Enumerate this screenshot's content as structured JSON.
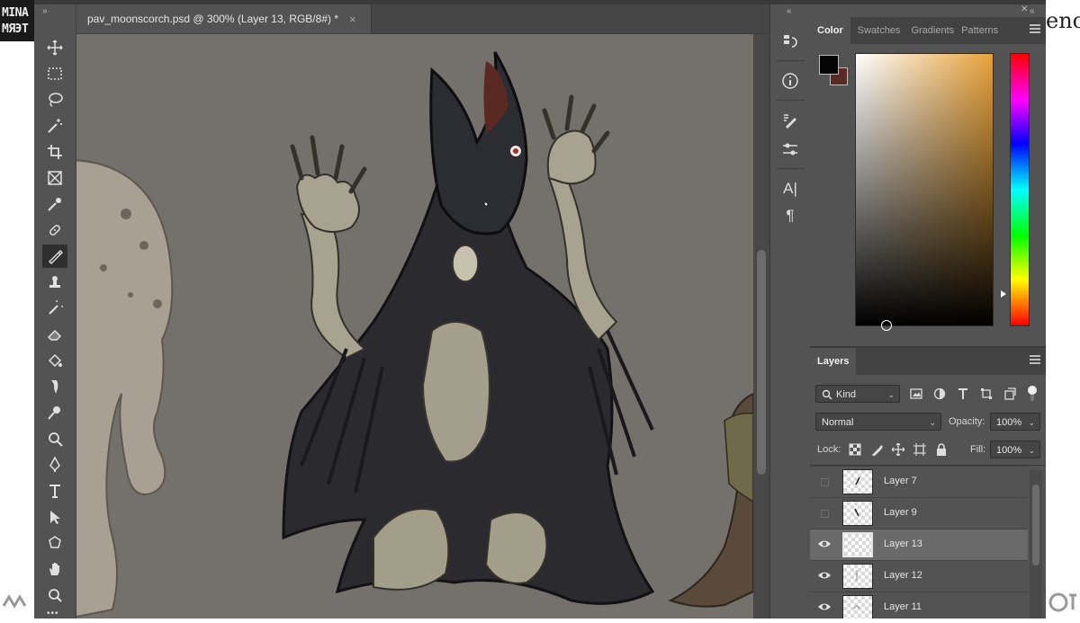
{
  "backdrop": {
    "top_left_text_1": "MINA",
    "top_left_text_2": "ΜЯЭТ",
    "top_right_text": "enc"
  },
  "document": {
    "tab_title": "pav_moonscorch.psd @ 300% (Layer 13, RGB/8#) *",
    "close_symbol": "×"
  },
  "toolbar": {
    "collapse_symbol": "»",
    "more_symbol": "•••",
    "tools": [
      "move-tool",
      "marquee-tool",
      "lasso-tool",
      "magic-wand-tool",
      "crop-tool",
      "frame-tool",
      "eyedropper-tool",
      "healing-brush-tool",
      "brush-tool",
      "clone-stamp-tool",
      "history-brush-tool",
      "eraser-tool",
      "paint-bucket-tool",
      "smudge-tool",
      "dodge-tool",
      "pen-tool",
      "type-tool",
      "path-selection-tool",
      "shape-tool",
      "hand-tool",
      "zoom-tool"
    ],
    "active_tool": "brush-tool"
  },
  "dock": {
    "collapse_symbol": "«",
    "text_symbol": "A|",
    "paragraph_symbol": "¶"
  },
  "color_panel": {
    "collapse_symbol": "«",
    "close_symbol": "✕",
    "tabs": [
      "Color",
      "Swatches",
      "Gradients",
      "Patterns"
    ],
    "active_tab": "Color",
    "foreground_color": "#050505",
    "background_color": "#5a2b24",
    "hue_color": "#e8a23a"
  },
  "layers_panel": {
    "tab": "Layers",
    "filter_label": "Kind",
    "blend_mode": "Normal",
    "opacity_label": "Opacity:",
    "opacity_value": "100%",
    "lock_label": "Lock:",
    "fill_label": "Fill:",
    "fill_value": "100%",
    "layers": [
      {
        "name": "Layer 7",
        "visible": false,
        "selected": false
      },
      {
        "name": "Layer 9",
        "visible": false,
        "selected": false
      },
      {
        "name": "Layer 13",
        "visible": true,
        "selected": true
      },
      {
        "name": "Layer 12",
        "visible": true,
        "selected": false
      },
      {
        "name": "Layer 11",
        "visible": true,
        "selected": false
      }
    ]
  }
}
